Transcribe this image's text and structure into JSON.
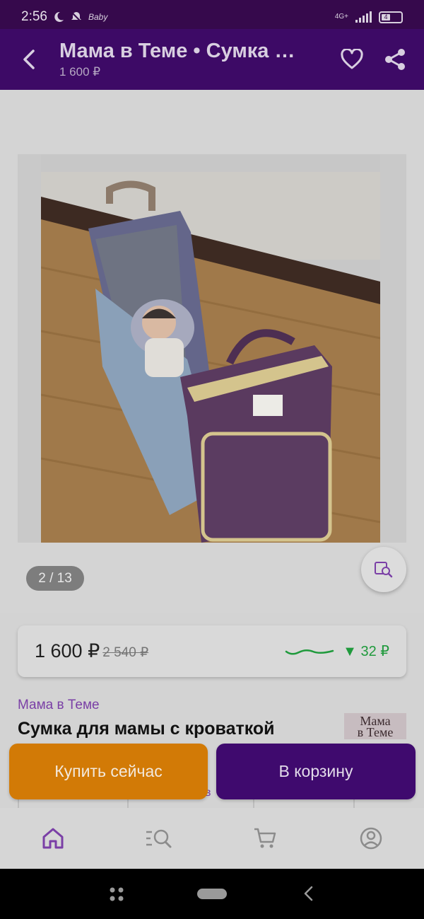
{
  "status_bar": {
    "time": "2:56",
    "icons": [
      "moon-icon",
      "notifications-muted-icon",
      "baby-app-icon"
    ],
    "app_badge_text": "Baby",
    "network": "4G+",
    "battery": "4"
  },
  "app_bar": {
    "title": "Мама в Теме • Сумка для мамы с кроваткой",
    "subtitle": "1 600 ₽",
    "icons": [
      "back-arrow-icon",
      "heart-icon",
      "share-icon"
    ]
  },
  "gallery": {
    "counter": "2 / 13",
    "image_alt": "Фиолетовая сумка-рюкзак с раскладной кроваткой, в которой лежит малыш",
    "search_icon": "image-search-icon"
  },
  "price": {
    "current": "1 600 ₽",
    "old": "2 540 ₽",
    "drop": "▼ 32 ₽",
    "colors": {
      "drop": "#1f9a3c"
    }
  },
  "product": {
    "brand": "Мама в Теме",
    "name": "Сумка для мамы с кроваткой",
    "brand_logo_line1": "Мама",
    "brand_logo_line2": "в Теме",
    "peek_text": "в"
  },
  "actions": {
    "buy_now": "Купить сейчас",
    "add_to_cart": "В корзину",
    "colors": {
      "buy": "#d27a06",
      "cart": "#3f0a6e"
    }
  },
  "tab_bar": {
    "tabs": [
      {
        "name": "home",
        "icon": "home-icon",
        "active": true
      },
      {
        "name": "catalog",
        "icon": "catalog-search-icon",
        "active": false
      },
      {
        "name": "cart",
        "icon": "cart-icon",
        "active": false
      },
      {
        "name": "profile",
        "icon": "profile-icon",
        "active": false
      }
    ]
  },
  "nav_bar": {
    "icons": [
      "apps-icon",
      "home-pill-icon",
      "back-nav-icon"
    ]
  }
}
